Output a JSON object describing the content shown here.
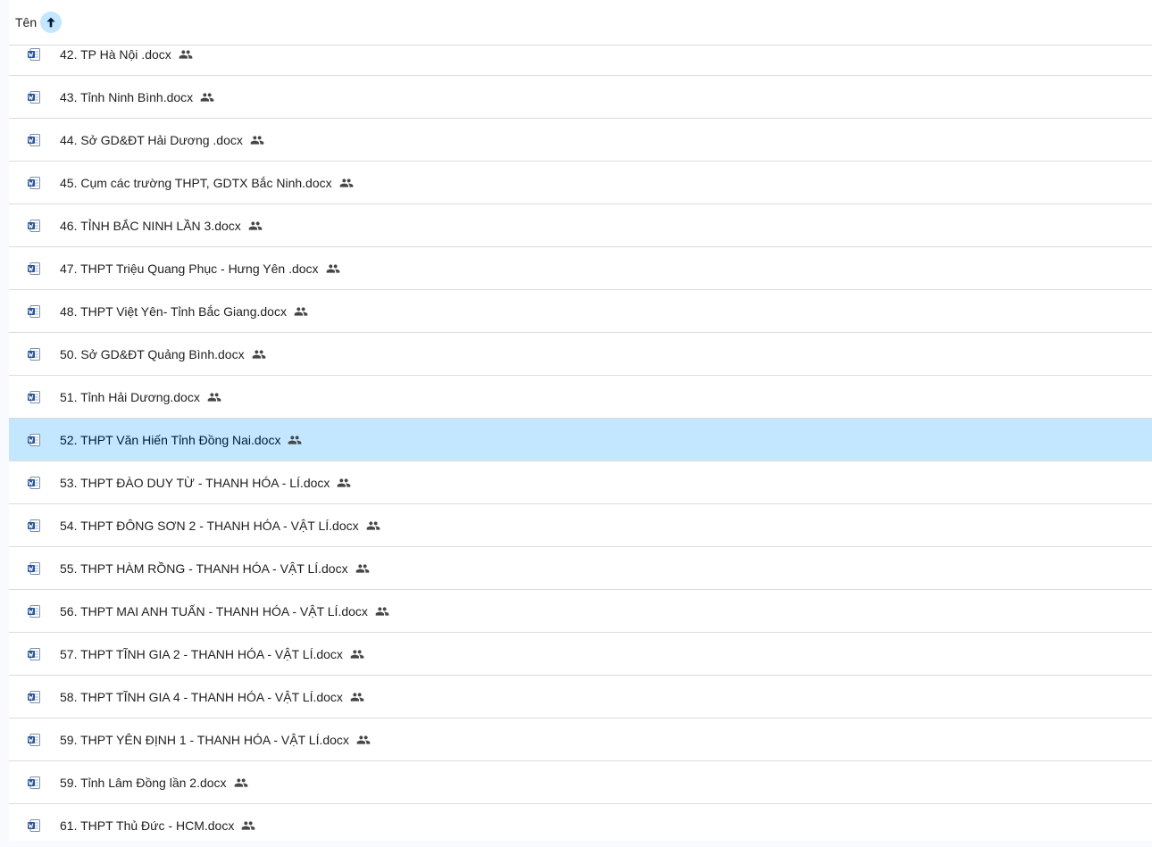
{
  "header": {
    "name_label": "Tên",
    "sort_direction": "ascending"
  },
  "colors": {
    "selected_row": "#c2e7ff",
    "word_icon": "#2b579a",
    "divider": "#dadce0"
  },
  "files": [
    {
      "name": "42. TP Hà Nội .docx",
      "icon": "word-doc-icon",
      "shared": true,
      "selected": false
    },
    {
      "name": "43. Tỉnh Ninh Bình.docx",
      "icon": "word-doc-icon",
      "shared": true,
      "selected": false
    },
    {
      "name": "44. Sở GD&ĐT Hải Dương .docx",
      "icon": "word-doc-icon",
      "shared": true,
      "selected": false
    },
    {
      "name": "45. Cụm các trường THPT, GDTX Bắc Ninh.docx",
      "icon": "word-doc-icon",
      "shared": true,
      "selected": false
    },
    {
      "name": "46. TỈNH BẮC NINH LẦN 3.docx",
      "icon": "word-doc-icon",
      "shared": true,
      "selected": false
    },
    {
      "name": "47. THPT Triệu Quang Phục - Hưng Yên .docx",
      "icon": "word-doc-icon",
      "shared": true,
      "selected": false
    },
    {
      "name": "48. THPT Việt Yên- Tỉnh Bắc Giang.docx",
      "icon": "word-doc-icon",
      "shared": true,
      "selected": false
    },
    {
      "name": "50. Sở GD&ĐT Quảng Bình.docx",
      "icon": "word-doc-icon",
      "shared": true,
      "selected": false
    },
    {
      "name": "51. Tỉnh Hải Dương.docx",
      "icon": "word-doc-icon",
      "shared": true,
      "selected": false
    },
    {
      "name": "52. THPT Văn Hiến Tỉnh Đồng Nai.docx",
      "icon": "word-doc-icon",
      "shared": true,
      "selected": true
    },
    {
      "name": "53. THPT ĐÀO DUY TỪ - THANH HÓA - LÍ.docx",
      "icon": "word-doc-icon",
      "shared": true,
      "selected": false
    },
    {
      "name": "54. THPT ĐÔNG SƠN 2 - THANH HÓA - VẬT LÍ.docx",
      "icon": "word-doc-icon",
      "shared": true,
      "selected": false
    },
    {
      "name": "55. THPT HÀM RỒNG - THANH HÓA - VẬT LÍ.docx",
      "icon": "word-doc-icon",
      "shared": true,
      "selected": false
    },
    {
      "name": "56. THPT MAI ANH TUẤN - THANH HÓA - VẬT LÍ.docx",
      "icon": "word-doc-icon",
      "shared": true,
      "selected": false
    },
    {
      "name": "57. THPT TĨNH GIA 2 - THANH HÓA - VẬT LÍ.docx",
      "icon": "word-doc-icon",
      "shared": true,
      "selected": false
    },
    {
      "name": "58. THPT TĨNH GIA 4 - THANH HÓA - VẬT LÍ.docx",
      "icon": "word-doc-icon",
      "shared": true,
      "selected": false
    },
    {
      "name": "59. THPT YÊN ĐỊNH 1 - THANH HÓA - VẬT LÍ.docx",
      "icon": "word-doc-icon",
      "shared": true,
      "selected": false
    },
    {
      "name": "59. Tỉnh Lâm Đồng lần 2.docx",
      "icon": "word-doc-icon",
      "shared": true,
      "selected": false
    },
    {
      "name": "61. THPT Thủ Đức - HCM.docx",
      "icon": "word-doc-icon",
      "shared": true,
      "selected": false
    }
  ]
}
